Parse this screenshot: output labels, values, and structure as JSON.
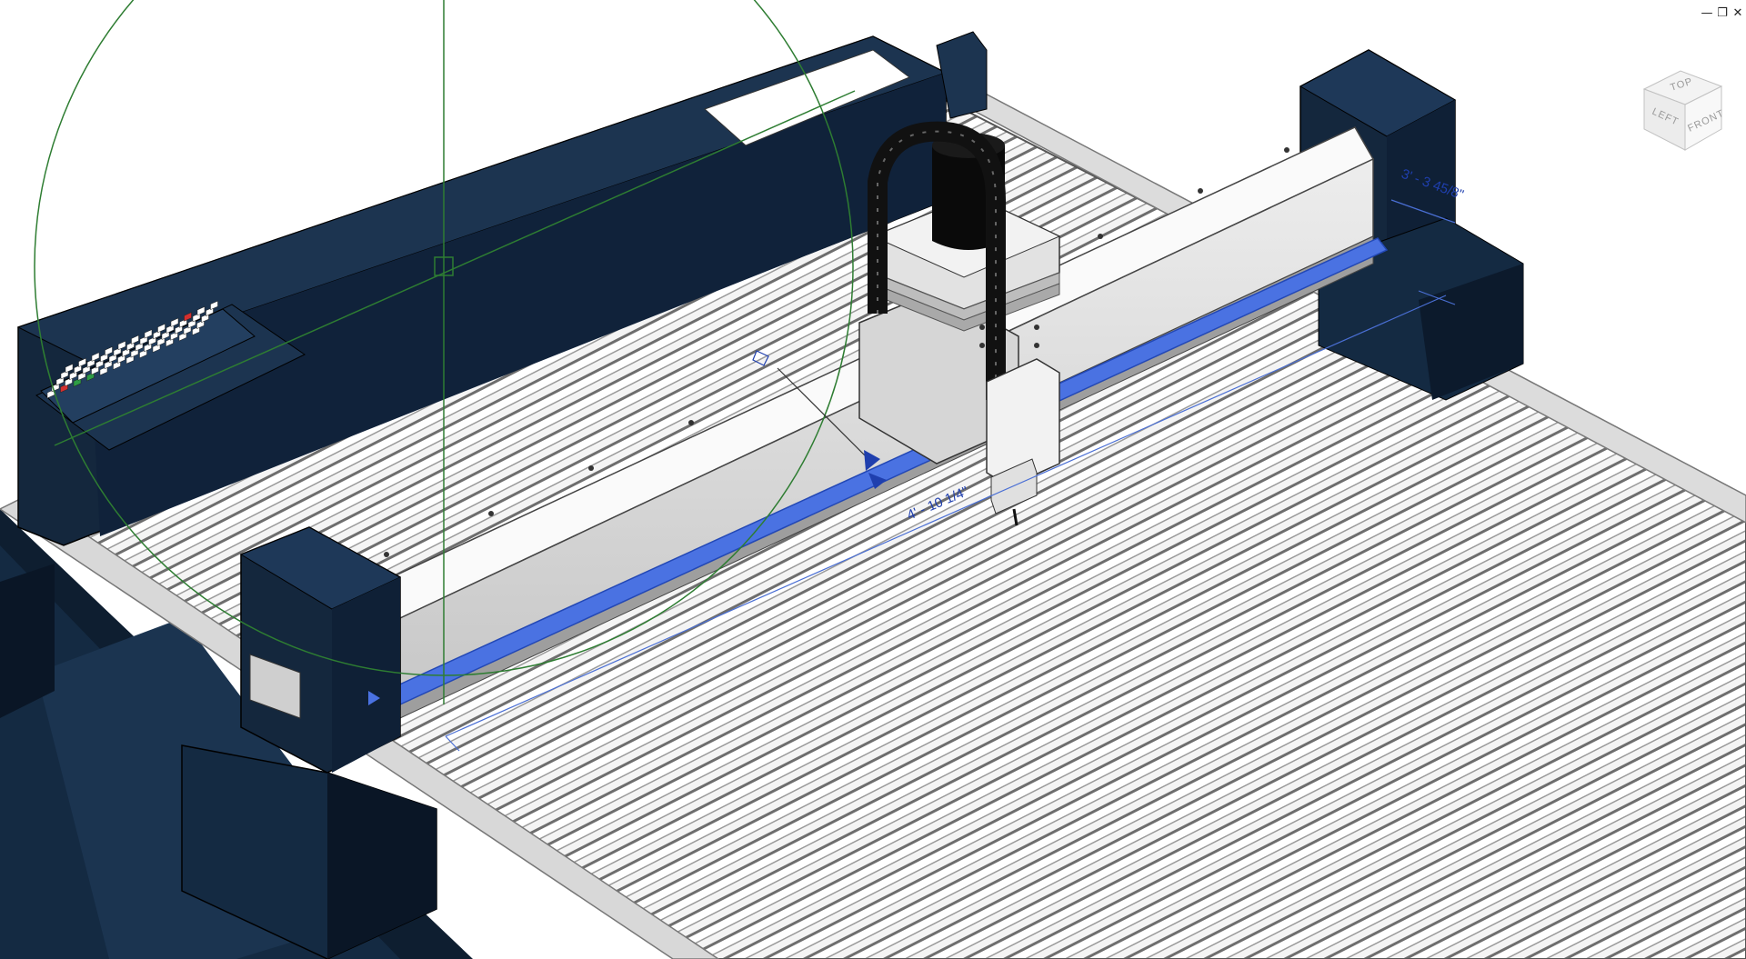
{
  "viewport": {
    "window_controls": {
      "minimize_glyph": "—",
      "restore_glyph": "❐",
      "close_glyph": "✕"
    },
    "view_cube": {
      "top_label": "TOP",
      "front_label": "FRONT",
      "left_label": "LEFT"
    },
    "dimensions": {
      "gantry_length": "4' - 10 1/4\"",
      "right_dimension": "3' - 3 45/8\""
    },
    "colors": {
      "machine_body": "#14273d",
      "rail_highlight": "#4a72e2",
      "grid_line": "#2e7d32",
      "dimension": "#1f3fae",
      "table_slat": "#e8e8e8"
    }
  }
}
